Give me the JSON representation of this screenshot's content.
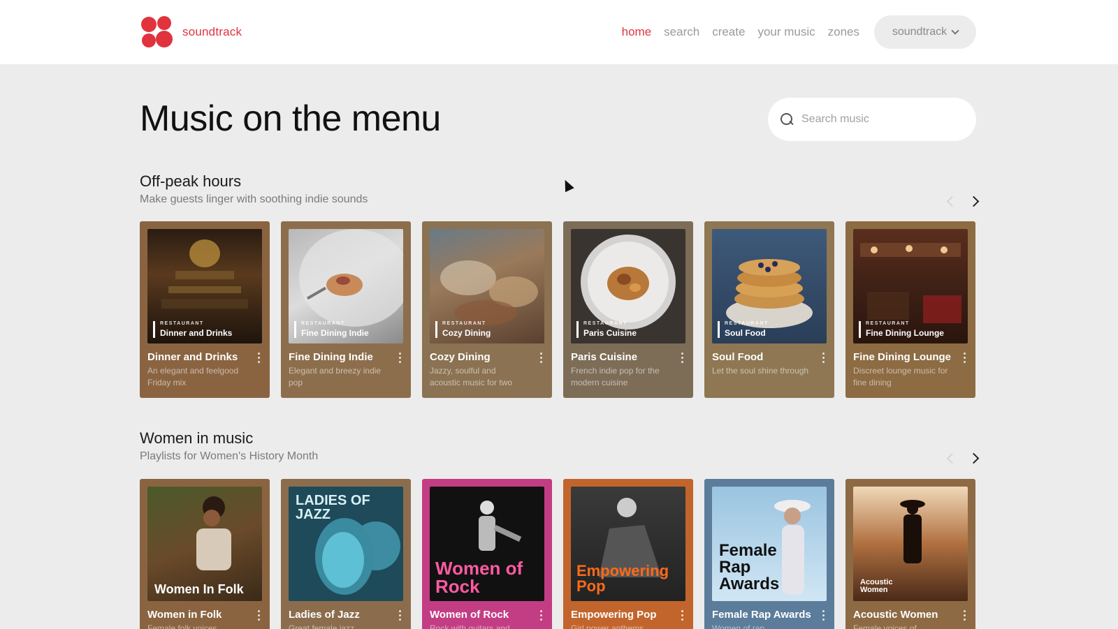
{
  "header": {
    "brand": "soundtrack",
    "nav": [
      "home",
      "search",
      "create",
      "your music",
      "zones"
    ],
    "active_nav": "home",
    "account_label": "soundtrack"
  },
  "page_title": "Music on the menu",
  "search": {
    "placeholder": "Search music"
  },
  "colors": {
    "accent": "#e0333d"
  },
  "sections": [
    {
      "title": "Off-peak hours",
      "subtitle": "Make guests linger with soothing indie sounds",
      "cards": [
        {
          "kicker": "RESTAURANT",
          "cover_label": "Dinner and Drinks",
          "title": "Dinner and Drinks",
          "description": "An elegant and feelgood Friday mix",
          "color": "#8a6441"
        },
        {
          "kicker": "RESTAURANT",
          "cover_label": "Fine Dining Indie",
          "title": "Fine Dining Indie",
          "description": "Elegant and breezy indie pop",
          "color": "#8d6e4c"
        },
        {
          "kicker": "RESTAURANT",
          "cover_label": "Cozy Dining",
          "title": "Cozy Dining",
          "description": "Jazzy, soulful and acoustic music for two",
          "color": "#8b7252"
        },
        {
          "kicker": "RESTAURANT",
          "cover_label": "Paris Cuisine",
          "title": "Paris Cuisine",
          "description": "French indie pop for the modern cuisine",
          "color": "#7d6d57"
        },
        {
          "kicker": "RESTAURANT",
          "cover_label": "Soul Food",
          "title": "Soul Food",
          "description": "Let the soul shine through",
          "color": "#8e7752"
        },
        {
          "kicker": "RESTAURANT",
          "cover_label": "Fine Dining Lounge",
          "title": "Fine Dining Lounge",
          "description": "Discreet lounge music for fine dining",
          "color": "#8d6b43"
        }
      ]
    },
    {
      "title": "Women in music",
      "subtitle": "Playlists for Women's History Month",
      "cards": [
        {
          "cover_label": "Women In Folk",
          "title": "Women in Folk",
          "description": "Female folk voices",
          "color": "#8a6441"
        },
        {
          "cover_label": "LADIES OF JAZZ",
          "title": "Ladies of Jazz",
          "description": "Great female jazz",
          "color": "#8b6d4d"
        },
        {
          "cover_label": "Women of Rock",
          "title": "Women of Rock",
          "description": "Rock with guitars and",
          "color": "#c23d84"
        },
        {
          "cover_label": "Empowering Pop",
          "title": "Empowering Pop",
          "description": "Girl power anthems",
          "color": "#c2652c"
        },
        {
          "cover_label": "Female Rap Awards",
          "title": "Female Rap Awards",
          "description": "Women of rap",
          "color": "#5b7c9a"
        },
        {
          "cover_label": "Acoustic Women",
          "title": "Acoustic Women",
          "description": "Female voices of",
          "color": "#8e6a44"
        }
      ]
    }
  ]
}
